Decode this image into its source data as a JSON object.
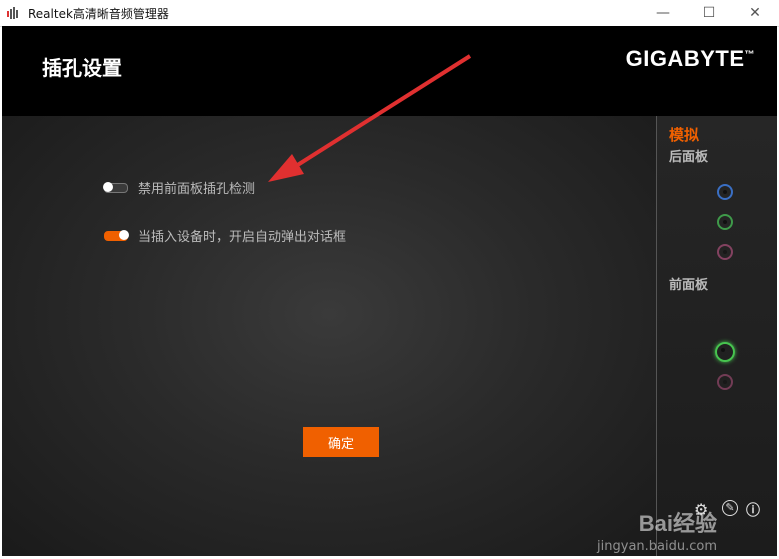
{
  "window": {
    "title": "Realtek高清晰音频管理器",
    "min_symbol": "—",
    "max_symbol": "☐",
    "close_symbol": "✕"
  },
  "header": {
    "page_title": "插孔设置",
    "brand": "GIGABYTE",
    "brand_mark": "™"
  },
  "options": [
    {
      "label": "禁用前面板插孔检测",
      "enabled": false
    },
    {
      "label": "当插入设备时，开启自动弹出对话框",
      "enabled": true
    }
  ],
  "ok_button": "确定",
  "sidebar": {
    "tab": "模拟",
    "rear_panel": "后面板",
    "front_panel": "前面板",
    "rear_jacks": [
      {
        "color": "#3a6fc4",
        "icon": "line-in-jack"
      },
      {
        "color": "#3f9a4a",
        "icon": "line-out-jack"
      },
      {
        "color": "#c4588a",
        "icon": "mic-jack"
      }
    ],
    "front_jacks": [
      {
        "color": "#47c44f",
        "icon": "headphone-jack",
        "active": true
      },
      {
        "color": "#c4588a",
        "icon": "mic-jack"
      }
    ]
  },
  "watermark": {
    "brand": "Bai经验",
    "url": "jingyan.baidu.com"
  },
  "colors": {
    "accent": "#f06000",
    "header_bg": "#000000"
  }
}
